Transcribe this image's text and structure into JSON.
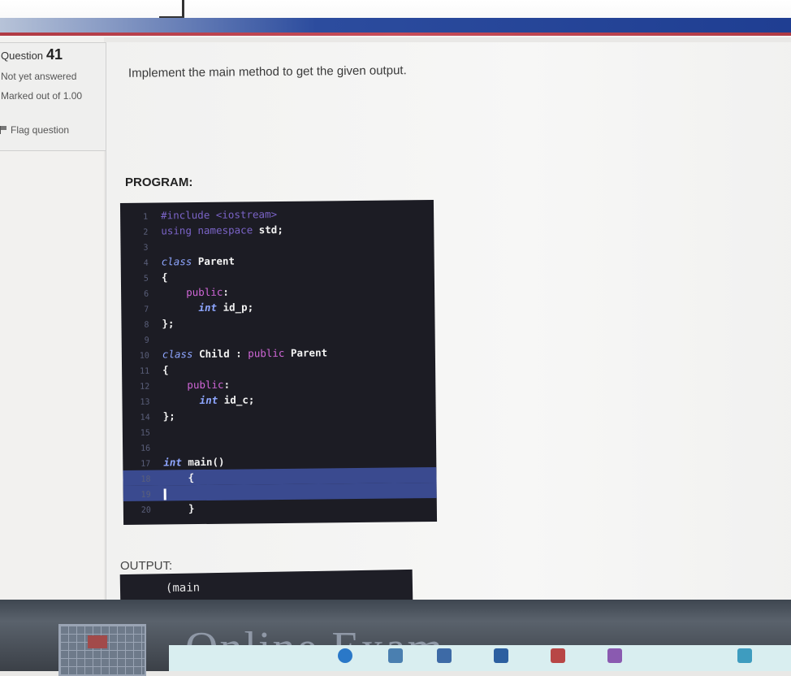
{
  "sidebar": {
    "question_prefix": "Question",
    "question_number": "41",
    "status": "Not yet answered",
    "marked_out_of": "Marked out of 1.00",
    "flag_label": "Flag question"
  },
  "question": {
    "prompt": "Implement the main method to get the given output.",
    "program_label": "PROGRAM:",
    "output_label": "OUTPUT:"
  },
  "code": {
    "lines": [
      {
        "n": "1",
        "segments": [
          {
            "t": "#include <iostream>",
            "c": "kw-pre"
          }
        ]
      },
      {
        "n": "2",
        "segments": [
          {
            "t": "using namespace ",
            "c": "kw-pre"
          },
          {
            "t": "std;",
            "c": "bold"
          }
        ]
      },
      {
        "n": "3",
        "segments": []
      },
      {
        "n": "4",
        "segments": [
          {
            "t": "class",
            "c": "kw-cls"
          },
          {
            "t": " Parent",
            "c": "bold"
          }
        ]
      },
      {
        "n": "5",
        "segments": [
          {
            "t": "{",
            "c": "bold"
          }
        ]
      },
      {
        "n": "6",
        "segments": [
          {
            "t": "    public",
            "c": "kw-pub"
          },
          {
            "t": ":",
            "c": "bold"
          }
        ]
      },
      {
        "n": "7",
        "segments": [
          {
            "t": "      ",
            "c": ""
          },
          {
            "t": "int",
            "c": "kw-int"
          },
          {
            "t": " id_p;",
            "c": "bold"
          }
        ]
      },
      {
        "n": "8",
        "segments": [
          {
            "t": "};",
            "c": "bold"
          }
        ]
      },
      {
        "n": "9",
        "segments": []
      },
      {
        "n": "10",
        "segments": [
          {
            "t": "class",
            "c": "kw-cls"
          },
          {
            "t": " Child : ",
            "c": "bold"
          },
          {
            "t": "public",
            "c": "kw-pub"
          },
          {
            "t": " Parent",
            "c": "bold"
          }
        ]
      },
      {
        "n": "11",
        "segments": [
          {
            "t": "{",
            "c": "bold"
          }
        ]
      },
      {
        "n": "12",
        "segments": [
          {
            "t": "    public",
            "c": "kw-pub"
          },
          {
            "t": ":",
            "c": "bold"
          }
        ]
      },
      {
        "n": "13",
        "segments": [
          {
            "t": "      ",
            "c": ""
          },
          {
            "t": "int",
            "c": "kw-int"
          },
          {
            "t": " id_c;",
            "c": "bold"
          }
        ]
      },
      {
        "n": "14",
        "segments": [
          {
            "t": "};",
            "c": "bold"
          }
        ]
      },
      {
        "n": "15",
        "segments": []
      },
      {
        "n": "16",
        "segments": []
      },
      {
        "n": "17",
        "segments": [
          {
            "t": "int",
            "c": "kw-int"
          },
          {
            "t": " main()",
            "c": "bold"
          }
        ]
      },
      {
        "n": "18",
        "segments": [
          {
            "t": "    {",
            "c": "bold"
          }
        ],
        "highlight": true
      },
      {
        "n": "19",
        "segments": [],
        "cursor": true,
        "highlight": true
      },
      {
        "n": "20",
        "segments": [
          {
            "t": "    }",
            "c": "bold"
          }
        ]
      }
    ]
  },
  "output": {
    "first_line": "(main"
  },
  "bezel": {
    "brand": "Online Exam"
  },
  "icons": {
    "flag": "flag-icon",
    "logo": "university-logo"
  }
}
